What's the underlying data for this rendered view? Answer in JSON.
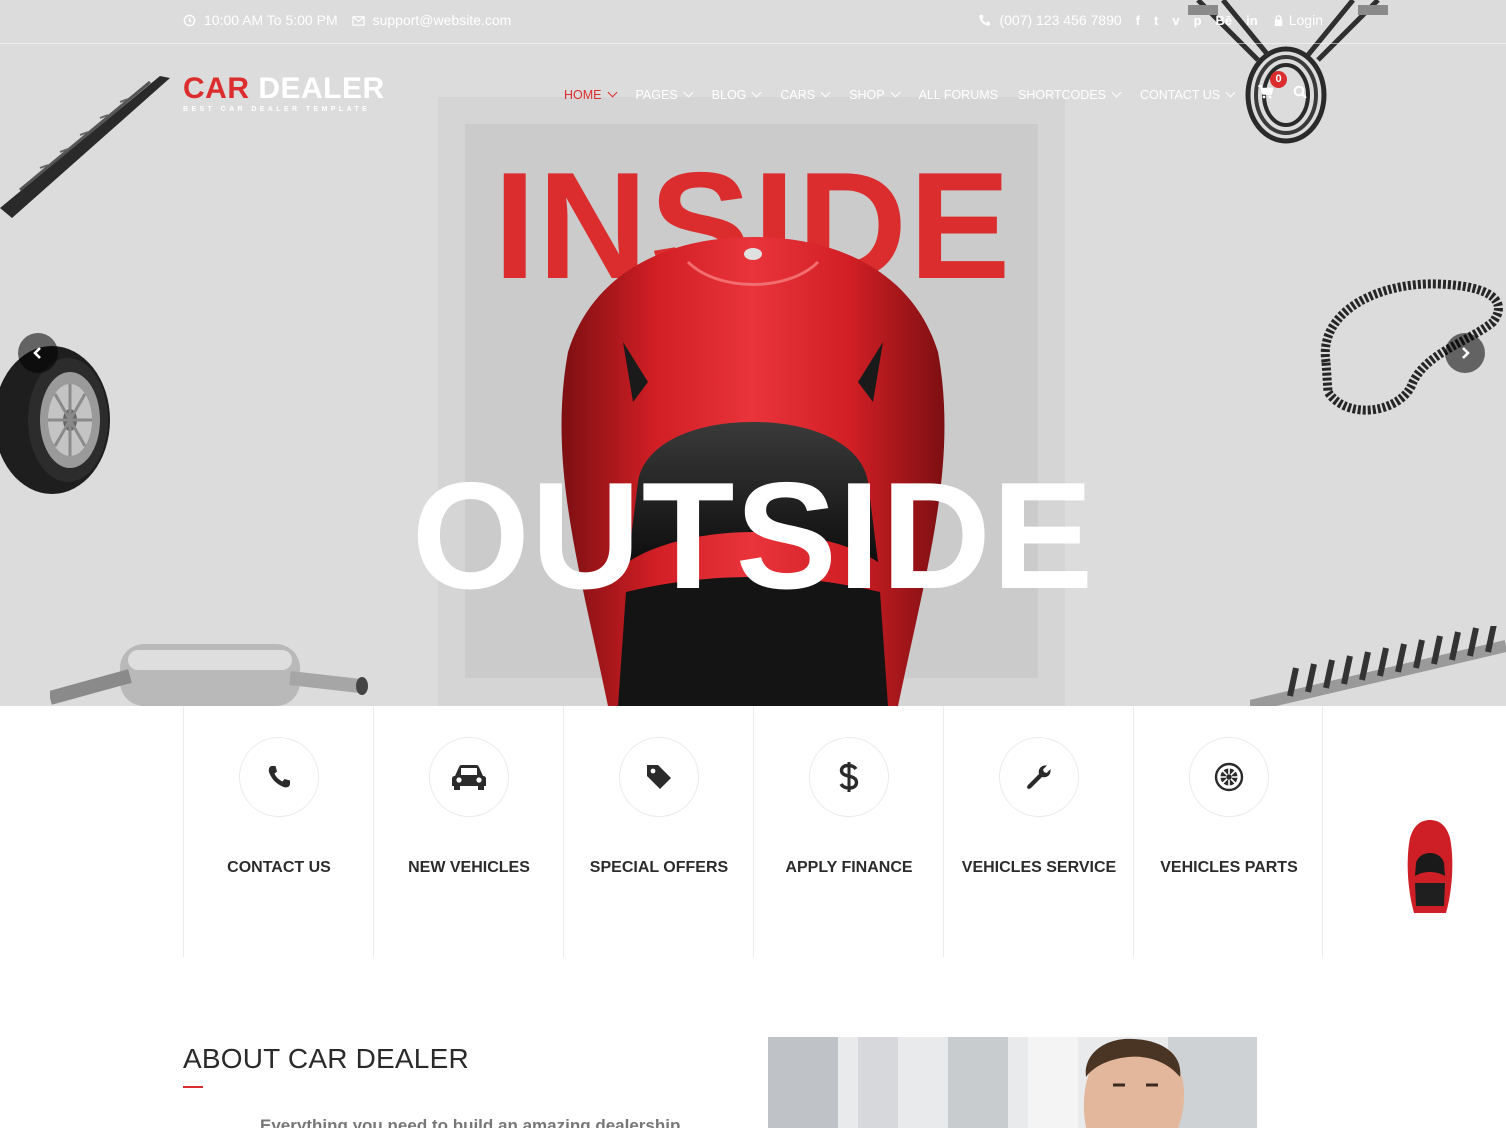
{
  "topbar": {
    "hours": "10:00 AM To 5:00 PM",
    "email": "support@website.com",
    "phone": "(007) 123 456 7890",
    "social": [
      "f",
      "t",
      "v",
      "p",
      "Bē",
      "in"
    ],
    "login": "Login"
  },
  "brand": {
    "name_red": "CAR",
    "name_white": "DEALER",
    "tagline": "BEST CAR DEALER TEMPLATE"
  },
  "nav": {
    "items": [
      {
        "label": "HOME",
        "dropdown": true,
        "active": true
      },
      {
        "label": "PAGES",
        "dropdown": true
      },
      {
        "label": "BLOG",
        "dropdown": true
      },
      {
        "label": "CARS",
        "dropdown": true
      },
      {
        "label": "SHOP",
        "dropdown": true
      },
      {
        "label": "ALL FORUMS",
        "dropdown": false
      },
      {
        "label": "SHORTCODES",
        "dropdown": true
      },
      {
        "label": "CONTACT US",
        "dropdown": true
      }
    ],
    "cart_count": "0",
    "icons": [
      "cart-icon",
      "search-icon"
    ]
  },
  "hero": {
    "headline_top": "INSIDE",
    "headline_bottom": "OUTSIDE"
  },
  "services": [
    {
      "label": "CONTACT US",
      "icon": "phone-icon"
    },
    {
      "label": "NEW VEHICLES",
      "icon": "car-icon"
    },
    {
      "label": "SPECIAL OFFERS",
      "icon": "tag-icon"
    },
    {
      "label": "APPLY FINANCE",
      "icon": "dollar-icon"
    },
    {
      "label": "VEHICLES SERVICE",
      "icon": "wrench-icon"
    },
    {
      "label": "VEHICLES PARTS",
      "icon": "wheel-icon"
    }
  ],
  "about": {
    "title": "ABOUT CAR DEALER",
    "text": "Everything you need to build an amazing dealership"
  },
  "colors": {
    "accent": "#db2d2e",
    "hero_bg": "#dcdcdc",
    "text_dark": "#2c2c2c"
  }
}
